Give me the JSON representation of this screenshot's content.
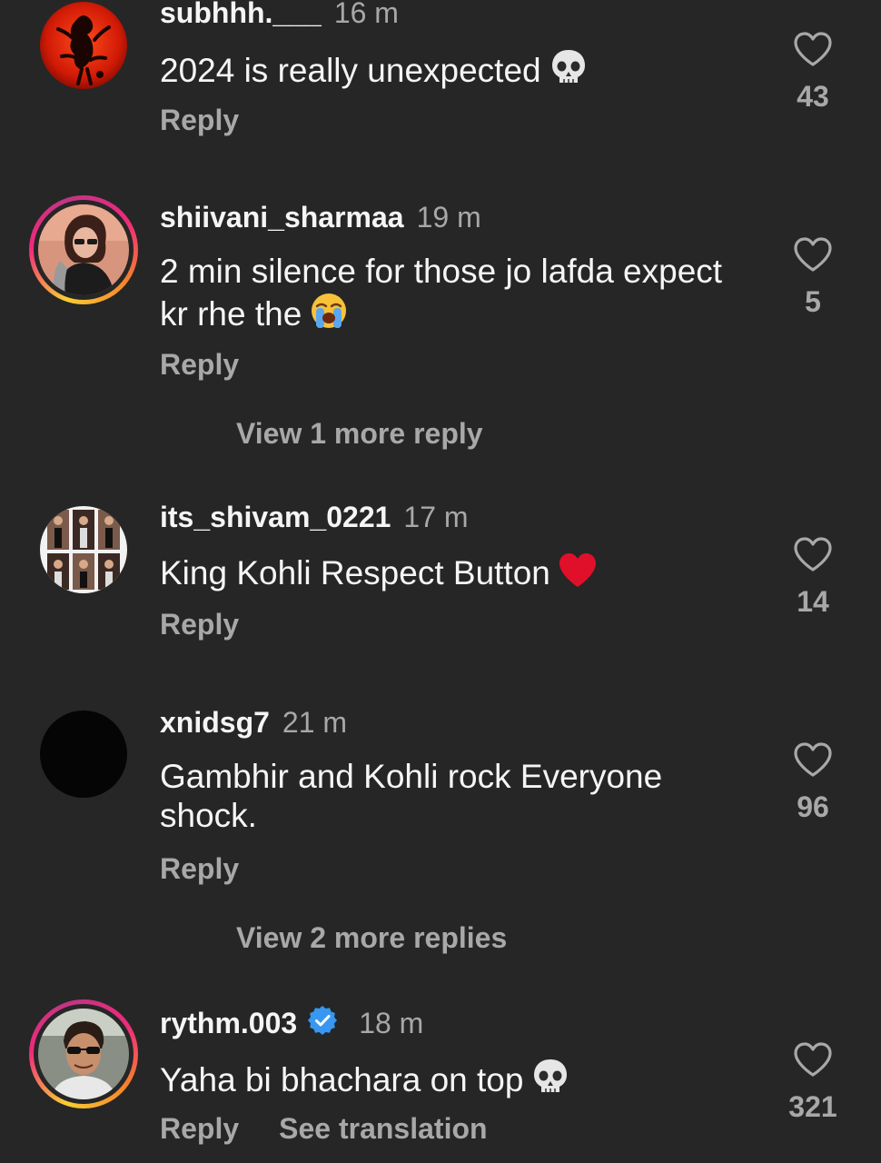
{
  "colors": {
    "background": "#262626",
    "primary_text": "#f5f5f5",
    "secondary_text": "#a8a8a8",
    "verified_blue": "#3897f0",
    "heart_red": "#e0102a"
  },
  "comments": [
    {
      "username": "subhhh.___",
      "time": "16 m",
      "text": "2024 is really unexpected",
      "emoji": "skull-emoji",
      "reply_label": "Reply",
      "likes": "43",
      "avatar": "red-illustration-avatar"
    },
    {
      "username": "shiivani_sharmaa",
      "time": "19 m",
      "text_line1": "2 min silence for those jo lafda expect",
      "text_line2": "kr rhe the",
      "emoji": "loudly-crying-face-emoji",
      "reply_label": "Reply",
      "likes": "5",
      "view_more": "View 1 more reply",
      "avatar": "woman-photo-avatar"
    },
    {
      "username": "its_shivam_0221",
      "time": "17 m",
      "text": "King Kohli Respect Button",
      "emoji": "red-heart-emoji",
      "reply_label": "Reply",
      "likes": "14",
      "avatar": "photo-grid-avatar"
    },
    {
      "username": "xnidsg7",
      "time": "21 m",
      "text_line1": "Gambhir and Kohli rock Everyone",
      "text_line2": "shock.",
      "reply_label": "Reply",
      "likes": "96",
      "view_more": "View 2 more replies",
      "avatar": "black-avatar"
    },
    {
      "username": "rythm.003",
      "verified": true,
      "time": "18 m",
      "text": "Yaha bi bhachara on top",
      "emoji": "skull-emoji",
      "reply_label": "Reply",
      "translation_label": "See translation",
      "likes": "321",
      "avatar": "man-photo-avatar"
    }
  ]
}
